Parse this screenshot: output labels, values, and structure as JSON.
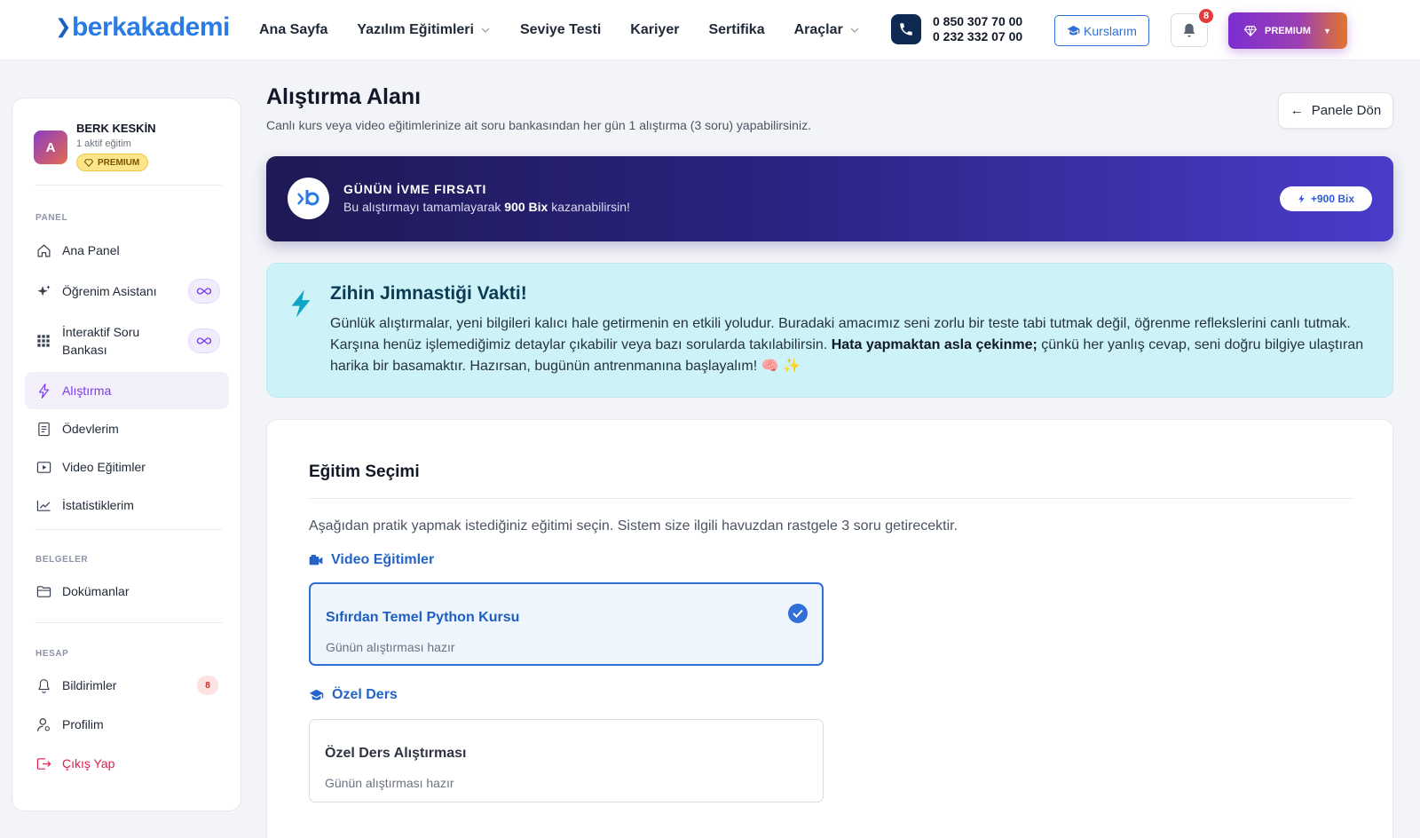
{
  "header": {
    "logo": "berkakademi",
    "nav": [
      {
        "label": "Ana Sayfa",
        "dropdown": false
      },
      {
        "label": "Yazılım Eğitimleri",
        "dropdown": true
      },
      {
        "label": "Seviye Testi",
        "dropdown": false
      },
      {
        "label": "Kariyer",
        "dropdown": false
      },
      {
        "label": "Sertifika",
        "dropdown": false
      },
      {
        "label": "Araçlar",
        "dropdown": true
      }
    ],
    "phone1": "0 850 307 70 00",
    "phone2": "0 232 332 07 00",
    "courses_label": "Kurslarım",
    "notification_count": "8",
    "premium_label": "PREMIUM"
  },
  "sidebar": {
    "user_name": "BERK KESKİN",
    "user_initial": "A",
    "user_sub": "1 aktif eğitim",
    "badge": "PREMIUM",
    "sections": {
      "panel": "PANEL",
      "belgeler": "BELGELER",
      "hesap": "HESAP"
    },
    "items": [
      {
        "label": "Ana Panel",
        "icon": "home-icon"
      },
      {
        "label": "Öğrenim Asistanı",
        "icon": "sparkle-icon"
      },
      {
        "label": "İnteraktif Soru Bankası",
        "icon": "grid-icon"
      },
      {
        "label": "Alıştırma",
        "icon": "bolt-icon",
        "active": true
      },
      {
        "label": "Ödevlerim",
        "icon": "document-icon"
      },
      {
        "label": "Video Eğitimler",
        "icon": "video-icon"
      },
      {
        "label": "İstatistiklerim",
        "icon": "chart-icon"
      },
      {
        "label": "Dokümanlar",
        "icon": "folder-icon"
      },
      {
        "label": "Bildirimler",
        "icon": "bell-icon",
        "count": "8"
      },
      {
        "label": "Profilim",
        "icon": "user-icon"
      },
      {
        "label": "Çıkış Yap",
        "icon": "logout-icon"
      }
    ]
  },
  "main": {
    "title": "Alıştırma Alanı",
    "subtitle": "Canlı kurs veya video eğitimlerinize ait soru bankasından her gün 1 alıştırma (3 soru) yapabilirsiniz.",
    "back_label": "Panele Dön",
    "promo": {
      "title": "GÜNÜN İVME FIRSATI",
      "desc_prefix": "Bu alıştırmayı tamamlayarak",
      "desc_amount": "900 Bix",
      "desc_suffix": "kazanabilirsin!",
      "pill": "+900 Bix"
    },
    "tip": {
      "title": "Zihin Jimnastiği Vakti!",
      "text_a": "Günlük alıştırmalar, yeni bilgileri kalıcı hale getirmenin en etkili yoludur. Buradaki amacımız seni zorlu bir teste tabi tutmak değil, öğrenme reflekslerini canlı tutmak. Karşına henüz işlemediğimiz detaylar çıkabilir veya bazı sorularda takılabilirsin.",
      "text_bold": "Hata yapmaktan asla çekinme;",
      "text_b": "çünkü her yanlış cevap, seni doğru bilgiye ulaştıran harika bir basamaktır. Hazırsan, bugünün antrenmanına başlayalım! 🧠 ✨"
    },
    "selection": {
      "title": "Eğitim Seçimi",
      "desc": "Aşağıdan pratik yapmak istediğiniz eğitimi seçin. Sistem size ilgili havuzdan rastgele 3 soru getirecektir.",
      "groups": [
        {
          "heading": "Video Eğitimler",
          "option_title": "Sıfırdan Temel Python Kursu",
          "option_sub": "Günün alıştırması hazır",
          "selected": true
        },
        {
          "heading": "Özel Ders",
          "option_title": "Özel Ders Alıştırması",
          "option_sub": "Günün alıştırması hazır",
          "selected": false
        }
      ]
    }
  },
  "colors": {
    "brand_blue": "#2a7be4",
    "accent_purple": "#7c3aed",
    "promo_dark": "#1e1a54",
    "tip_bg": "#cdf2f8",
    "logout_red": "#e11d48"
  }
}
